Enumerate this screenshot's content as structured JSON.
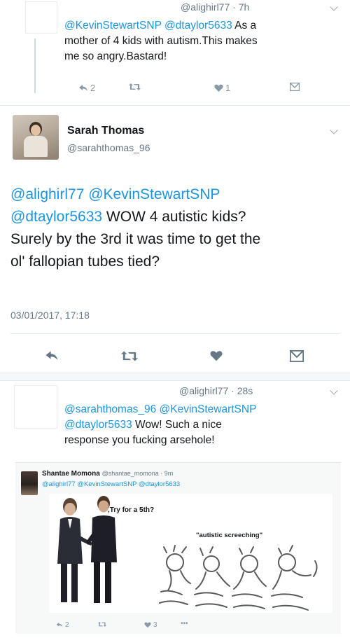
{
  "tweet1": {
    "handle_time": "@alighirl77 · 7h",
    "mentions": "@KevinStewartSNP @dtaylor5633",
    "text_after_mentions": " As a",
    "text_line2": "mother of 4 kids with autism.This makes",
    "text_line3": "me so angry.Bastard!",
    "reply_count": "2",
    "like_count": "1",
    "icons": [
      "reply-icon",
      "retweet-icon",
      "like-icon",
      "message-icon",
      "chevron-down-icon"
    ]
  },
  "tweet2": {
    "name": "Sarah Thomas",
    "handle": "@sarahthomas_96",
    "line1": "@alighirl77 @KevinStewartSNP",
    "line2_mention": "@dtaylor5633",
    "line2_text": " WOW 4 autistic kids?",
    "line3": "Surely by the 3rd it was time to get the",
    "line4": "ol' fallopian tubes tied?",
    "timestamp": "03/01/2017, 17:18",
    "icons": [
      "reply-icon",
      "retweet-icon",
      "heart-icon",
      "message-icon",
      "chevron-down-icon"
    ]
  },
  "tweet3": {
    "handle_time": "@alighirl77 · 28s",
    "line1": "@sarahthomas_96 @KevinStewartSNP",
    "line2_mention": "@dtaylor5633",
    "line2_text": " Wow! Such a nice",
    "line3": "response you fucking arsehole!"
  },
  "quoted": {
    "name": "Shantae Momona",
    "handle_time": "@shantae_momona · 9m",
    "mentions": "@alighirl77 @KevinStewartSNP @dtaylor5633",
    "caption1": ",Try for a 5th?",
    "caption2": "\"autistic screeching\"",
    "reply_count": "2",
    "like_count": "3",
    "more": "•••"
  },
  "colors": {
    "link": "#1b95e0",
    "muted": "#657786",
    "icon": "#8899a6"
  }
}
